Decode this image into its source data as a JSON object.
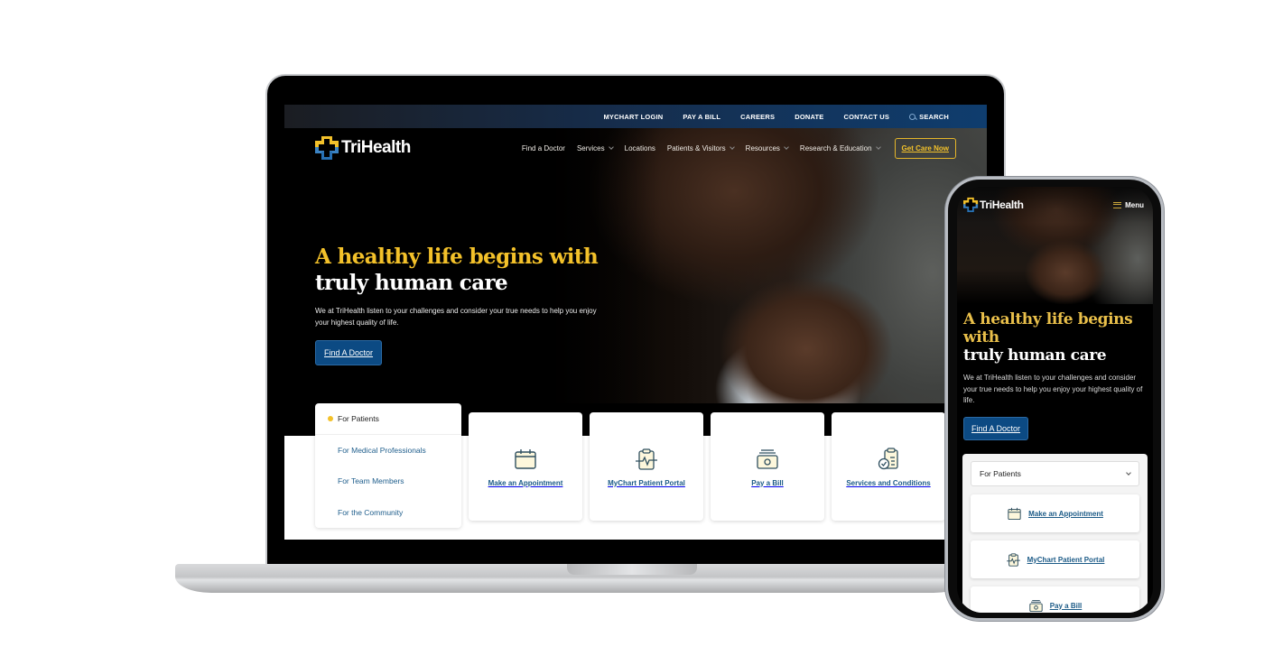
{
  "brand": {
    "name": "TriHealth",
    "colors": {
      "gold": "#f3c12a",
      "navy": "#0c4a83",
      "link_blue": "#1c5b87",
      "logo_blue": "#3b83c3"
    }
  },
  "desktop": {
    "utility_nav": [
      {
        "label": "MYCHART LOGIN"
      },
      {
        "label": "PAY A BILL"
      },
      {
        "label": "CAREERS"
      },
      {
        "label": "DONATE"
      },
      {
        "label": "CONTACT US"
      },
      {
        "label": "SEARCH",
        "icon": "search-icon"
      }
    ],
    "main_nav": [
      {
        "label": "Find a Doctor",
        "dropdown": false
      },
      {
        "label": "Services",
        "dropdown": true
      },
      {
        "label": "Locations",
        "dropdown": false
      },
      {
        "label": "Patients & Visitors",
        "dropdown": true
      },
      {
        "label": "Resources",
        "dropdown": true
      },
      {
        "label": "Research & Education",
        "dropdown": true
      }
    ],
    "cta_button": "Get Care Now",
    "hero": {
      "headline_gold": "A healthy life begins with",
      "headline_white": "truly human care",
      "subtext": "We at TriHealth listen to your challenges and consider your true needs to help you enjoy your highest quality of life.",
      "button": "Find A Doctor"
    },
    "audience_tabs": [
      {
        "label": "For Patients",
        "active": true
      },
      {
        "label": "For Medical Professionals",
        "active": false
      },
      {
        "label": "For Team Members",
        "active": false
      },
      {
        "label": "For the Community",
        "active": false
      }
    ],
    "quick_links": [
      {
        "label": "Make an Appointment",
        "icon": "calendar-icon"
      },
      {
        "label": "MyChart Patient Portal",
        "icon": "clipboard-heartbeat-icon"
      },
      {
        "label": "Pay a Bill",
        "icon": "cash-icon"
      },
      {
        "label": "Services and Conditions",
        "icon": "checklist-icon"
      }
    ]
  },
  "mobile": {
    "menu_label": "Menu",
    "hero": {
      "headline_gold": "A healthy life begins with",
      "headline_white": "truly human care",
      "subtext": "We at TriHealth listen to your challenges and consider your true needs to help you enjoy your highest quality of life.",
      "button": "Find A Doctor"
    },
    "audience_select": {
      "selected": "For Patients"
    },
    "quick_links": [
      {
        "label": "Make an Appointment",
        "icon": "calendar-icon"
      },
      {
        "label": "MyChart Patient Portal",
        "icon": "clipboard-heartbeat-icon"
      },
      {
        "label": "Pay a Bill",
        "icon": "cash-icon"
      }
    ]
  }
}
